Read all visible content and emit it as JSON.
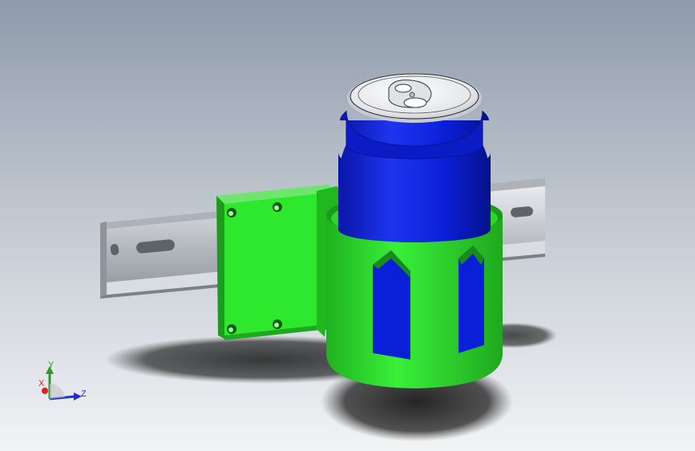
{
  "viewport": {
    "background_top": "#8f9bab",
    "background_bottom": "#f2f3f5"
  },
  "model": {
    "bracket_color": "#2ee82e",
    "bracket_dark": "#1fa81f",
    "can_body_color": "#0a1fd8",
    "can_lid_color": "#e6e8ec",
    "rail_color": "#c8cbd0"
  },
  "triad": {
    "x_label": "X",
    "y_label": "Y",
    "z_label": "Z",
    "x_color": "#e02020",
    "y_color": "#2a9a2a",
    "z_color": "#2030d0"
  }
}
